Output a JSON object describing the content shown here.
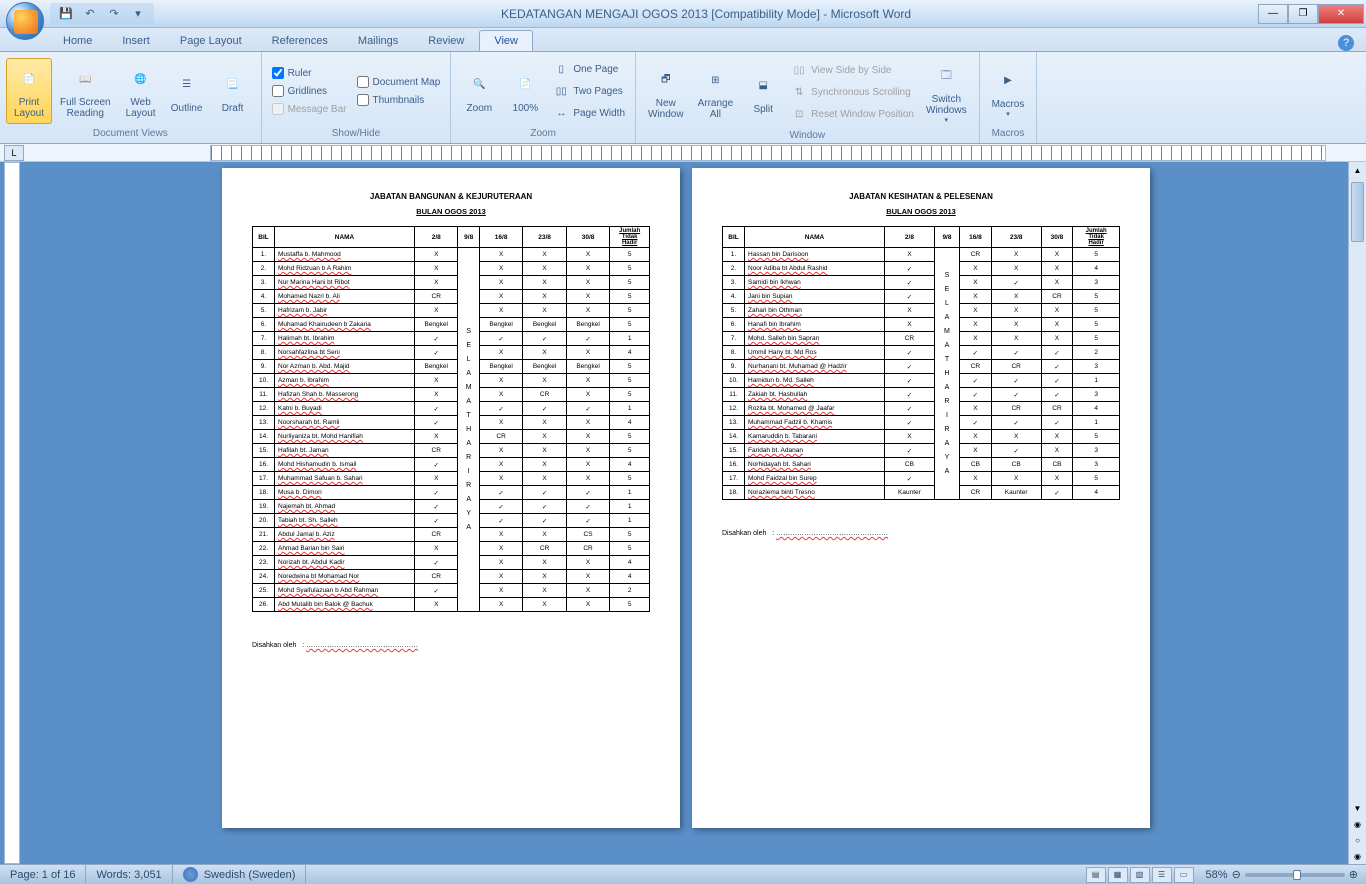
{
  "title": "KEDATANGAN MENGAJI OGOS 2013 [Compatibility Mode] - Microsoft Word",
  "tabs": {
    "home": "Home",
    "insert": "Insert",
    "pagelayout": "Page Layout",
    "references": "References",
    "mailings": "Mailings",
    "review": "Review",
    "view": "View"
  },
  "ribbon": {
    "docviews": {
      "label": "Document Views",
      "print": "Print\nLayout",
      "full": "Full Screen\nReading",
      "web": "Web\nLayout",
      "outline": "Outline",
      "draft": "Draft"
    },
    "showhide": {
      "label": "Show/Hide",
      "ruler": "Ruler",
      "gridlines": "Gridlines",
      "msgbar": "Message Bar",
      "docmap": "Document Map",
      "thumbs": "Thumbnails"
    },
    "zoom": {
      "label": "Zoom",
      "zoom": "Zoom",
      "z100": "100%",
      "onepage": "One Page",
      "twopages": "Two Pages",
      "pagewidth": "Page Width"
    },
    "window": {
      "label": "Window",
      "new": "New\nWindow",
      "arrange": "Arrange\nAll",
      "split": "Split",
      "sbs": "View Side by Side",
      "sync": "Synchronous Scrolling",
      "reset": "Reset Window Position",
      "switch": "Switch\nWindows"
    },
    "macros": {
      "label": "Macros",
      "macros": "Macros"
    }
  },
  "page1": {
    "title": "JABATAN BANGUNAN & KEJURUTERAAN",
    "sub": "BULAN OGOS  2013",
    "headers": [
      "BIL",
      "NAMA",
      "2/8",
      "9/8",
      "16/8",
      "23/8",
      "30/8",
      "Jumlah Tidak Hadir"
    ],
    "vtext": "SELAMAT HARI RAYA",
    "rows": [
      [
        "1.",
        "Mustaffa b. Mahmood",
        "X",
        "",
        "X",
        "X",
        "X",
        "5"
      ],
      [
        "2.",
        "Mohd Ridzuan b A Rahim",
        "X",
        "",
        "X",
        "X",
        "X",
        "5"
      ],
      [
        "3.",
        "Nur Marina Hani bt Ribot",
        "X",
        "",
        "X",
        "X",
        "X",
        "5"
      ],
      [
        "4.",
        "Mohamed Nazri b. Ali",
        "CR",
        "",
        "X",
        "X",
        "X",
        "5"
      ],
      [
        "5.",
        "Hafrizam b. Jabir",
        "X",
        "",
        "X",
        "X",
        "X",
        "5"
      ],
      [
        "6.",
        "Muhamad Khairudeen b Zakaria",
        "Bengkel",
        "",
        "Bengkel",
        "Bengkel",
        "Bengkel",
        "5"
      ],
      [
        "7.",
        "Halimah bt. Ibrahim",
        "✓",
        "",
        "✓",
        "✓",
        "✓",
        "1"
      ],
      [
        "8.",
        "Norsahfazlina bt Seni",
        "✓",
        "",
        "X",
        "X",
        "X",
        "4"
      ],
      [
        "9.",
        "Nor Azman b. Abd. Majid",
        "Bengkel",
        "",
        "Bengkel",
        "Bengkel",
        "Bengkel",
        "5"
      ],
      [
        "10.",
        "Azman b. Ibrahim",
        "X",
        "",
        "X",
        "X",
        "X",
        "5"
      ],
      [
        "11.",
        "Hafizan Shah b. Masserong",
        "X",
        "",
        "X",
        "CR",
        "X",
        "5"
      ],
      [
        "12.",
        "Katni b. Buyadi",
        "✓",
        "",
        "✓",
        "✓",
        "✓",
        "1"
      ],
      [
        "13.",
        "Noorsharah bt. Ramli",
        "✓",
        "",
        "X",
        "X",
        "X",
        "4"
      ],
      [
        "14.",
        "Nurliyaniza bt. Mohd Hanifiah",
        "X",
        "",
        "CR",
        "X",
        "X",
        "5"
      ],
      [
        "15.",
        "Hafilah bt. Jaman",
        "CR",
        "",
        "X",
        "X",
        "X",
        "5"
      ],
      [
        "16.",
        "Mohd Hishamudin b. Ismail",
        "✓",
        "",
        "X",
        "X",
        "X",
        "4"
      ],
      [
        "17.",
        "Muhammad Safuan b. Sahari",
        "X",
        "",
        "X",
        "X",
        "X",
        "5"
      ],
      [
        "18.",
        "Musa b. Dimon",
        "✓",
        "",
        "✓",
        "✓",
        "✓",
        "1"
      ],
      [
        "19.",
        "Najemah bt. Ahmad",
        "✓",
        "",
        "✓",
        "✓",
        "✓",
        "1"
      ],
      [
        "20.",
        "Tabiah bt. Sh. Salleh",
        "✓",
        "",
        "✓",
        "✓",
        "✓",
        "1"
      ],
      [
        "21.",
        "Abdul Jamal b. Aziz",
        "CR",
        "",
        "X",
        "X",
        "CS",
        "5"
      ],
      [
        "22.",
        "Ahmad Barian bin Sairi",
        "X",
        "",
        "X",
        "CR",
        "CR",
        "5"
      ],
      [
        "23.",
        "Norizah bt. Abdul Kadir",
        "✓",
        "",
        "X",
        "X",
        "X",
        "4"
      ],
      [
        "24.",
        "Noredwina bt Mohamad Nor",
        "CR",
        "",
        "X",
        "X",
        "X",
        "4"
      ],
      [
        "25.",
        "Mohd Syaifulazuan b Abd Rahman",
        "✓",
        "",
        "X",
        "X",
        "X",
        "2"
      ],
      [
        "26.",
        "Abd Mutalib bin Balok @ Bachuk",
        "X",
        "",
        "X",
        "X",
        "X",
        "5"
      ]
    ],
    "sign": "Disahkan oleh"
  },
  "page2": {
    "title": "JABATAN KESIHATAN & PELESENAN",
    "sub": "BULAN OGOS  2013",
    "headers": [
      "BIL",
      "NAMA",
      "2/8",
      "9/8",
      "16/8",
      "23/8",
      "30/8",
      "Jumlah Tidak Hadir"
    ],
    "vtext": "SELAMAT HARI RAYA",
    "rows": [
      [
        "1.",
        "Hassan bin Darisoon",
        "X",
        "",
        "CR",
        "X",
        "X",
        "5"
      ],
      [
        "2.",
        "Noor Adiba bt Abdul Rashid",
        "✓",
        "",
        "X",
        "X",
        "X",
        "4"
      ],
      [
        "3.",
        "Samidi bin Ikhwan",
        "✓",
        "",
        "X",
        "✓",
        "X",
        "3"
      ],
      [
        "4.",
        "Jani bin Supian",
        "✓",
        "",
        "X",
        "X",
        "CR",
        "5"
      ],
      [
        "5.",
        "Zahari bin Othman",
        "X",
        "",
        "X",
        "X",
        "X",
        "5"
      ],
      [
        "6.",
        "Hanafi bin Ibrahim",
        "X",
        "",
        "X",
        "X",
        "X",
        "5"
      ],
      [
        "7.",
        "Mohd. Salleh bin Sapran",
        "CR",
        "",
        "X",
        "X",
        "X",
        "5"
      ],
      [
        "8.",
        "Ummil Hany bt. Md Ros",
        "✓",
        "",
        "✓",
        "✓",
        "✓",
        "2"
      ],
      [
        "9.",
        "Nurhanani bt. Muhamad @ Hadzir",
        "✓",
        "",
        "CR",
        "CR",
        "✓",
        "3"
      ],
      [
        "10.",
        "Hamidun b. Md. Salleh",
        "✓",
        "",
        "✓",
        "✓",
        "✓",
        "1"
      ],
      [
        "11.",
        "Zakiah bt. Hasbullah",
        "✓",
        "",
        "✓",
        "✓",
        "✓",
        "3"
      ],
      [
        "12.",
        "Rozita bt. Mohamed @ Jaafar",
        "✓",
        "",
        "X",
        "CR",
        "CR",
        "4"
      ],
      [
        "13.",
        "Muhammad Fadzil b. Khamis",
        "✓",
        "",
        "✓",
        "✓",
        "✓",
        "1"
      ],
      [
        "14.",
        "Kamaruddin b. Tabarani",
        "X",
        "",
        "X",
        "X",
        "X",
        "5"
      ],
      [
        "15.",
        "Faridah bt. Adanan",
        "✓",
        "",
        "X",
        "✓",
        "X",
        "3"
      ],
      [
        "16.",
        "Norhidayah bt. Sahari",
        "CB",
        "",
        "CB",
        "CB",
        "CB",
        "3"
      ],
      [
        "17.",
        "Mohd Faidzal bin Surep",
        "✓",
        "",
        "X",
        "X",
        "X",
        "5"
      ],
      [
        "18.",
        "Noraziema binti Tresno",
        "Kaunter",
        "",
        "CR",
        "Kaunter",
        "✓",
        "4"
      ]
    ],
    "sign": "Disahkan oleh"
  },
  "statusbar": {
    "page": "Page: 1 of 16",
    "words": "Words: 3,051",
    "lang": "Swedish (Sweden)",
    "zoom": "58%"
  }
}
